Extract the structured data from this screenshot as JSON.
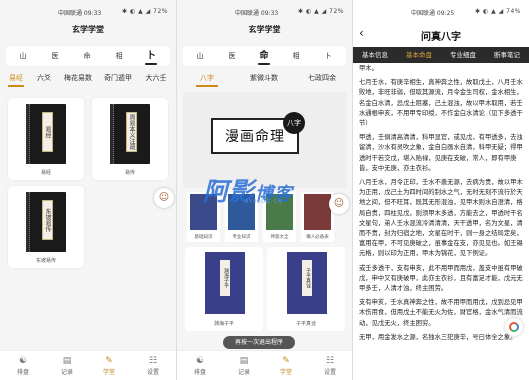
{
  "panel1": {
    "status": {
      "carrier": "中国联通 09:33",
      "icons": "✱ ◐ ▲ ◢ 72%"
    },
    "title": "玄学学堂",
    "main_tabs": [
      {
        "label": "山"
      },
      {
        "label": "医"
      },
      {
        "label": "命"
      },
      {
        "label": "相"
      },
      {
        "label": "卜"
      }
    ],
    "active_main_tab": "卜",
    "sub_tabs": [
      {
        "label": "易经"
      },
      {
        "label": "六爻"
      },
      {
        "label": "梅花易数"
      },
      {
        "label": "奇门遁甲"
      },
      {
        "label": "大六壬"
      }
    ],
    "active_sub_tab": "易经",
    "cards": [
      {
        "cover": "易经",
        "label": "易经"
      },
      {
        "cover": "周易本义注疏",
        "label": "易传"
      },
      {
        "cover": "东坡易传",
        "label": "东坡易传"
      }
    ]
  },
  "panel2": {
    "status": {
      "carrier": "中国联通 09:33",
      "icons": "✱ ◐ ▲ ◢ 72%"
    },
    "title": "玄学学堂",
    "main_tabs": [
      {
        "label": "山"
      },
      {
        "label": "医"
      },
      {
        "label": "命"
      },
      {
        "label": "相"
      },
      {
        "label": "卜"
      }
    ],
    "active_main_tab": "命",
    "sub_tabs": [
      {
        "label": "八字"
      },
      {
        "label": "紫微斗数"
      },
      {
        "label": "七政四余"
      }
    ],
    "active_sub_tab": "八字",
    "banner_title": "漫画命理",
    "banner_seal": "八字",
    "mini_books": [
      {
        "label": "基础知识",
        "color": "#3a4a8a"
      },
      {
        "label": "专业知识",
        "color": "#2f5a9a"
      },
      {
        "label": "神煞大全",
        "color": "#4a7a4a"
      },
      {
        "label": "懒人必备表",
        "color": "#7a3a3a"
      }
    ],
    "big_books": [
      {
        "cover": "渊海子平",
        "label": "渊海子平"
      },
      {
        "cover": "子平真诠",
        "label": "子平真诠"
      }
    ],
    "toast": "再按一次退出程序",
    "watermark_main": "阿影",
    "watermark_tail": "博客",
    "watermark_sub": "AYBLOG.CN"
  },
  "panel3": {
    "status": {
      "carrier": "中国联通 09:25",
      "icons": "✱ ◐ ▲ ◢ 74%"
    },
    "back_icon": "‹",
    "title": "问真八字",
    "tabs": [
      {
        "label": "基本信息"
      },
      {
        "label": "基本命盘"
      },
      {
        "label": "专业细盘"
      },
      {
        "label": "断事笔记"
      }
    ],
    "active_tab": "基本命盘",
    "paragraphs": [
      "甲木。",
      "七月壬水，有庚辛相生，真神奔之性，故取戊土，八月壬水败地，非旺非弱，但取其源流，月令金生司权，金水相生，名金白水清，忌戊土阻塞，己土混浊，故以甲木取用，若壬水通根申亥，不用甲专印绶，不作金白水清论（见下多透干节）",
      "甲透，壬俱清高清清，科甲显官，或见戊，有甲透多，去浊留清，沙水有灵吹之象，金自白画水自清，科甲无疑；得甲透时干若交戊，堪入贻禄，见庚在支破，常人，即有甲庚皆，支中无庚，亦主衣衫。",
      "八月壬水，月令正印，壬水不患无源，去病为贵，故以甲木为正用，戊己土为四时间的制水之气，无时无刻不流行於天地之间，但不旺耳，既其无形混浊，见甲木则水自澄清，格局自贵，四柱见戊，则须甲木多透，方能去之，甲透时干名文星句，弟人壬水混流冷清清清，天干透甲，名为文星，清而不贵，封为归宿之地，文星在时干，则一身之结局定矣，富用在甲，不可见庚破之，虽事金在支，亦见见也。如王锡元格，则以印为正用，甲木为锦花，见下例证。",
      "或壬多透干，支有申亥，此不用甲而用戊，盖支中虽有甲破戊，申中又有庚破甲，此亦主衣衫，且有富足才能，戊元无甲多壬，人清才浊，终主困劳。",
      "支有申亥，壬水真神奔之性，故不用甲而用戊，戊到忌见甲木伤用食，但用戊土不能无火为佐，财官格，金水气清而流动，见戊无火，终主困穷。",
      "无甲，用金发水之源，名独水三犯庚辛，号曰体全之象。"
    ]
  },
  "bottom_nav": [
    {
      "icon": "☯",
      "label": "排盘"
    },
    {
      "icon": "▤",
      "label": "记录"
    },
    {
      "icon": "✎",
      "label": "学堂"
    },
    {
      "icon": "☷",
      "label": "设置"
    }
  ],
  "active_nav": "学堂",
  "float_icon": "☺"
}
